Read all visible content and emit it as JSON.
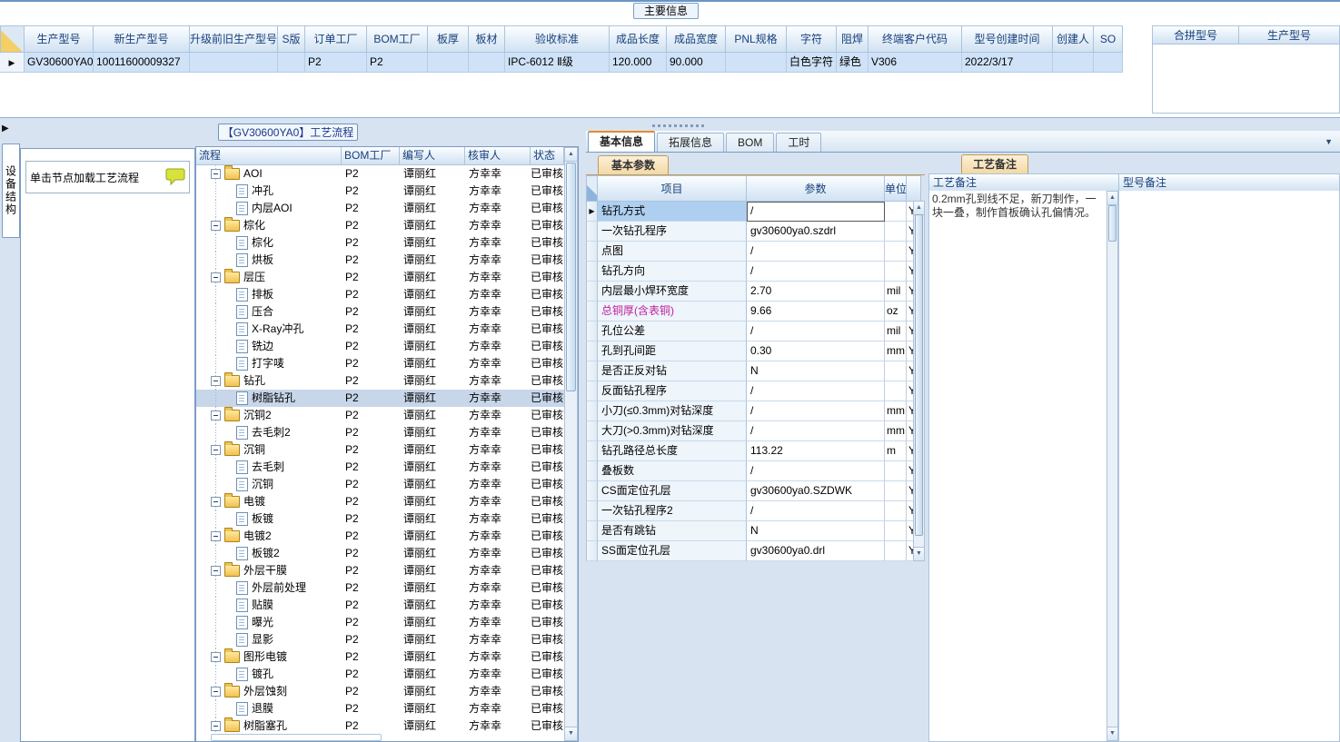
{
  "icons": {
    "row_indicator": "▶",
    "dock_arrow": "▶",
    "dropdown": "▼",
    "scroll_up": "▲",
    "scroll_down": "▼",
    "collapse": "−",
    "hint_bubble": "speech-bubble",
    "folder": "folder",
    "file": "document"
  },
  "main_info": {
    "tab_label": "主要信息",
    "columns": [
      "生产型号",
      "新生产型号",
      "升级前旧生产型号",
      "S版",
      "订单工厂",
      "BOM工厂",
      "板厚",
      "板材",
      "验收标准",
      "成品长度",
      "成品宽度",
      "PNL规格",
      "字符",
      "阻焊",
      "终端客户代码",
      "型号创建时间",
      "创建人",
      "SO"
    ],
    "row": [
      "GV30600YA0",
      "10011600009327",
      "",
      "",
      "P2",
      "P2",
      "",
      "",
      "IPC-6012 Ⅱ级",
      "120.000",
      "90.000",
      "",
      "白色字符",
      "绿色",
      "V306",
      "2022/3/17",
      "",
      ""
    ],
    "merge_grid_columns": [
      "合拼型号",
      "生产型号"
    ]
  },
  "left_panel": {
    "vertical_tab": "设备结构",
    "hint": "单击节点加载工艺流程"
  },
  "process_panel": {
    "title": "【GV30600YA0】工艺流程",
    "columns": [
      "流程",
      "BOM工厂",
      "编写人",
      "核审人",
      "状态"
    ],
    "rows": [
      {
        "label": "AOI",
        "type": "folder",
        "bom": "P2",
        "writer": "谭丽红",
        "reviewer": "方幸幸",
        "status": "已审核"
      },
      {
        "label": "冲孔",
        "type": "file",
        "bom": "P2",
        "writer": "谭丽红",
        "reviewer": "方幸幸",
        "status": "已审核"
      },
      {
        "label": "内层AOI",
        "type": "file",
        "bom": "P2",
        "writer": "谭丽红",
        "reviewer": "方幸幸",
        "status": "已审核"
      },
      {
        "label": "棕化",
        "type": "folder",
        "bom": "P2",
        "writer": "谭丽红",
        "reviewer": "方幸幸",
        "status": "已审核"
      },
      {
        "label": "棕化",
        "type": "file",
        "bom": "P2",
        "writer": "谭丽红",
        "reviewer": "方幸幸",
        "status": "已审核"
      },
      {
        "label": "烘板",
        "type": "file",
        "bom": "P2",
        "writer": "谭丽红",
        "reviewer": "方幸幸",
        "status": "已审核"
      },
      {
        "label": "层压",
        "type": "folder",
        "bom": "P2",
        "writer": "谭丽红",
        "reviewer": "方幸幸",
        "status": "已审核"
      },
      {
        "label": "排板",
        "type": "file",
        "bom": "P2",
        "writer": "谭丽红",
        "reviewer": "方幸幸",
        "status": "已审核"
      },
      {
        "label": "压合",
        "type": "file",
        "bom": "P2",
        "writer": "谭丽红",
        "reviewer": "方幸幸",
        "status": "已审核"
      },
      {
        "label": "X-Ray冲孔",
        "type": "file",
        "bom": "P2",
        "writer": "谭丽红",
        "reviewer": "方幸幸",
        "status": "已审核"
      },
      {
        "label": "铣边",
        "type": "file",
        "bom": "P2",
        "writer": "谭丽红",
        "reviewer": "方幸幸",
        "status": "已审核"
      },
      {
        "label": "打字唛",
        "type": "file",
        "bom": "P2",
        "writer": "谭丽红",
        "reviewer": "方幸幸",
        "status": "已审核"
      },
      {
        "label": "钻孔",
        "type": "folder",
        "bom": "P2",
        "writer": "谭丽红",
        "reviewer": "方幸幸",
        "status": "已审核"
      },
      {
        "label": "树脂钻孔",
        "type": "file",
        "selected": true,
        "bom": "P2",
        "writer": "谭丽红",
        "reviewer": "方幸幸",
        "status": "已审核"
      },
      {
        "label": "沉铜2",
        "type": "folder",
        "bom": "P2",
        "writer": "谭丽红",
        "reviewer": "方幸幸",
        "status": "已审核"
      },
      {
        "label": "去毛刺2",
        "type": "file",
        "bom": "P2",
        "writer": "谭丽红",
        "reviewer": "方幸幸",
        "status": "已审核"
      },
      {
        "label": "沉铜",
        "type": "folder",
        "bom": "P2",
        "writer": "谭丽红",
        "reviewer": "方幸幸",
        "status": "已审核"
      },
      {
        "label": "去毛刺",
        "type": "file",
        "bom": "P2",
        "writer": "谭丽红",
        "reviewer": "方幸幸",
        "status": "已审核"
      },
      {
        "label": "沉铜",
        "type": "file",
        "bom": "P2",
        "writer": "谭丽红",
        "reviewer": "方幸幸",
        "status": "已审核"
      },
      {
        "label": "电镀",
        "type": "folder",
        "bom": "P2",
        "writer": "谭丽红",
        "reviewer": "方幸幸",
        "status": "已审核"
      },
      {
        "label": "板镀",
        "type": "file",
        "bom": "P2",
        "writer": "谭丽红",
        "reviewer": "方幸幸",
        "status": "已审核"
      },
      {
        "label": "电镀2",
        "type": "folder",
        "bom": "P2",
        "writer": "谭丽红",
        "reviewer": "方幸幸",
        "status": "已审核"
      },
      {
        "label": "板镀2",
        "type": "file",
        "bom": "P2",
        "writer": "谭丽红",
        "reviewer": "方幸幸",
        "status": "已审核"
      },
      {
        "label": "外层干膜",
        "type": "folder",
        "bom": "P2",
        "writer": "谭丽红",
        "reviewer": "方幸幸",
        "status": "已审核"
      },
      {
        "label": "外层前处理",
        "type": "file",
        "bom": "P2",
        "writer": "谭丽红",
        "reviewer": "方幸幸",
        "status": "已审核"
      },
      {
        "label": "贴膜",
        "type": "file",
        "bom": "P2",
        "writer": "谭丽红",
        "reviewer": "方幸幸",
        "status": "已审核"
      },
      {
        "label": "曝光",
        "type": "file",
        "bom": "P2",
        "writer": "谭丽红",
        "reviewer": "方幸幸",
        "status": "已审核"
      },
      {
        "label": "显影",
        "type": "file",
        "bom": "P2",
        "writer": "谭丽红",
        "reviewer": "方幸幸",
        "status": "已审核"
      },
      {
        "label": "图形电镀",
        "type": "folder",
        "bom": "P2",
        "writer": "谭丽红",
        "reviewer": "方幸幸",
        "status": "已审核"
      },
      {
        "label": "镀孔",
        "type": "file",
        "bom": "P2",
        "writer": "谭丽红",
        "reviewer": "方幸幸",
        "status": "已审核"
      },
      {
        "label": "外层蚀刻",
        "type": "folder",
        "bom": "P2",
        "writer": "谭丽红",
        "reviewer": "方幸幸",
        "status": "已审核"
      },
      {
        "label": "退膜",
        "type": "file",
        "bom": "P2",
        "writer": "谭丽红",
        "reviewer": "方幸幸",
        "status": "已审核"
      },
      {
        "label": "树脂塞孔",
        "type": "folder",
        "bom": "P2",
        "writer": "谭丽红",
        "reviewer": "方幸幸",
        "status": "已审核"
      }
    ]
  },
  "detail_panel": {
    "tabs": [
      "基本信息",
      "拓展信息",
      "BOM",
      "工时"
    ],
    "selected_tab": "基本信息",
    "sub_tab": "基本参数",
    "columns": [
      "项目",
      "参数",
      "单位"
    ],
    "rows": [
      {
        "item": "钻孔方式",
        "value": "/",
        "unit": "",
        "flag": "Y",
        "selected": true
      },
      {
        "item": "一次钻孔程序",
        "value": "gv30600ya0.szdrl",
        "unit": "",
        "flag": "Y"
      },
      {
        "item": "点图",
        "value": "/",
        "unit": "",
        "flag": "Y"
      },
      {
        "item": "钻孔方向",
        "value": "/",
        "unit": "",
        "flag": "Y"
      },
      {
        "item": "内层最小焊环宽度",
        "value": "2.70",
        "unit": "mil",
        "flag": "Y"
      },
      {
        "item": "总铜厚(含表铜)",
        "value": "9.66",
        "unit": "oz",
        "flag": "Y",
        "highlight": true
      },
      {
        "item": "孔位公差",
        "value": "/",
        "unit": "mil",
        "flag": "Y"
      },
      {
        "item": "孔到孔间距",
        "value": "0.30",
        "unit": "mm",
        "flag": "Y"
      },
      {
        "item": "是否正反对钻",
        "value": "N",
        "unit": "",
        "flag": "Y"
      },
      {
        "item": "反面钻孔程序",
        "value": "/",
        "unit": "",
        "flag": "Y"
      },
      {
        "item": "小刀(≤0.3mm)对钻深度",
        "value": "/",
        "unit": "mm",
        "flag": "Y"
      },
      {
        "item": "大刀(>0.3mm)对钻深度",
        "value": "/",
        "unit": "mm",
        "flag": "Y"
      },
      {
        "item": "钻孔路径总长度",
        "value": "113.22",
        "unit": "m",
        "flag": "Y"
      },
      {
        "item": "叠板数",
        "value": "/",
        "unit": "",
        "flag": "Y"
      },
      {
        "item": "CS面定位孔层",
        "value": "gv30600ya0.SZDWK",
        "unit": "",
        "flag": "Y"
      },
      {
        "item": "一次钻孔程序2",
        "value": "/",
        "unit": "",
        "flag": "Y"
      },
      {
        "item": "是否有跳钻",
        "value": "N",
        "unit": "",
        "flag": "Y"
      },
      {
        "item": "SS面定位孔层",
        "value": "gv30600ya0.drl",
        "unit": "",
        "flag": "Y"
      }
    ]
  },
  "notes_panel": {
    "tab": "工艺备注",
    "columns": [
      "工艺备注",
      "型号备注"
    ],
    "process_note": "0.2mm孔到线不足，新刀制作，一块一叠，制作首板确认孔偏情况。",
    "model_note": ""
  },
  "colors": {
    "selection_blue": "#cfe2f7",
    "header_text": "#17407c",
    "highlight_magenta": "#c21e9c",
    "warm_tab": "#f3d9a4",
    "background": "#d7e3f1"
  }
}
